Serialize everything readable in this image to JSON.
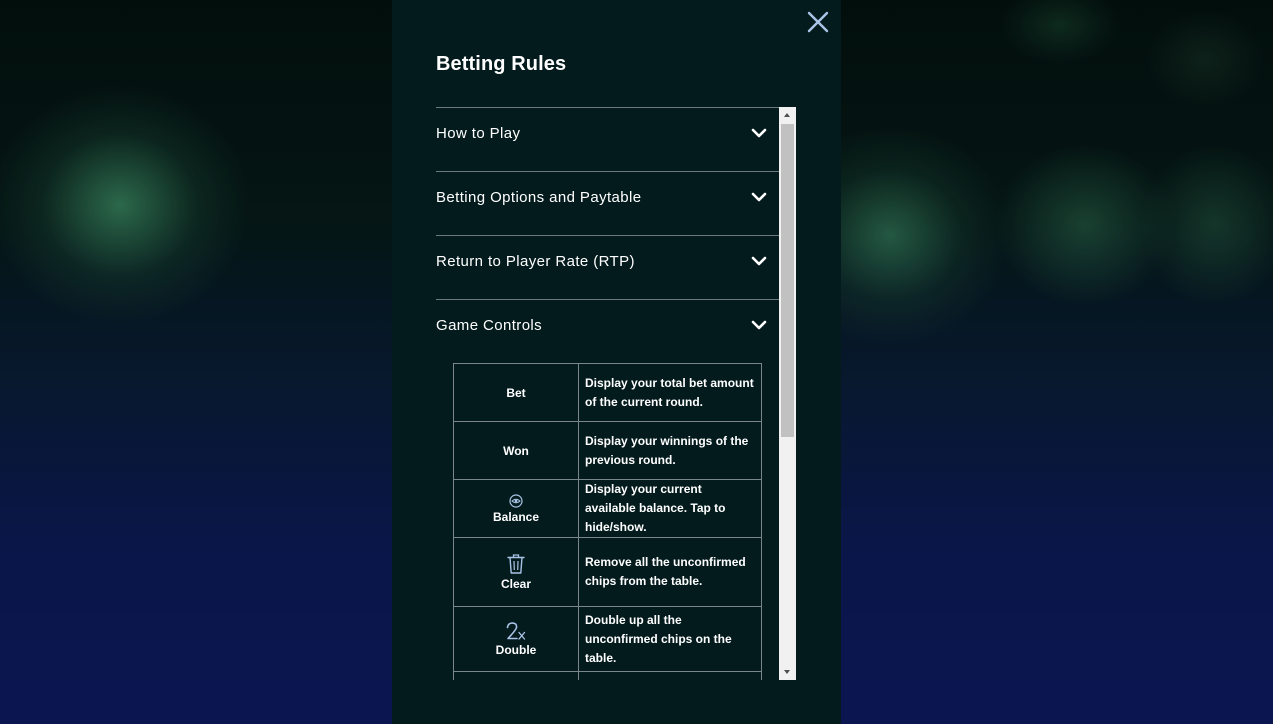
{
  "modal": {
    "title": "Betting Rules",
    "close_icon": "close-icon"
  },
  "sections": [
    {
      "label": "How to Play",
      "icon": "chevron-down-icon"
    },
    {
      "label": "Betting Options and Paytable",
      "icon": "chevron-down-icon"
    },
    {
      "label": "Return to Player Rate (RTP)",
      "icon": "chevron-down-icon"
    },
    {
      "label": "Game Controls",
      "icon": "chevron-down-icon"
    }
  ],
  "game_controls": [
    {
      "name": "Bet",
      "icon": null,
      "description": "Display your total bet amount of the current round."
    },
    {
      "name": "Won",
      "icon": null,
      "description": "Display your winnings of the previous round."
    },
    {
      "name": "Balance",
      "icon": "eye-icon",
      "description": "Display your current available balance. Tap to hide/show."
    },
    {
      "name": "Clear",
      "icon": "trash-icon",
      "description": "Remove all the unconfirmed chips from the table."
    },
    {
      "name": "Double",
      "icon": "double-2x-icon",
      "description": "Double up all the unconfirmed chips on the table."
    }
  ],
  "colors": {
    "modal_bg": "#041b1e",
    "divider": "#6b7a7c",
    "text": "#ffffff",
    "icon_accent": "#a9c4e6"
  }
}
